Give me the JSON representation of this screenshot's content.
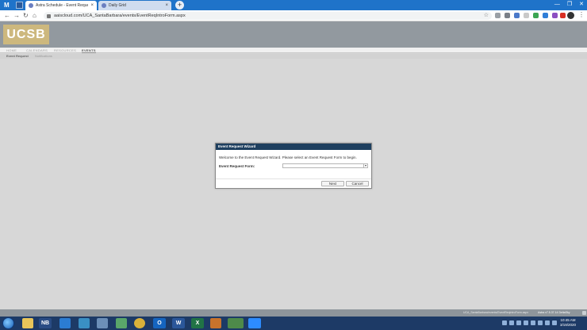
{
  "browser": {
    "tabs": [
      {
        "title": "Astra Schedule - Event Request",
        "close": "×"
      },
      {
        "title": "Daily Grid",
        "close": "×"
      }
    ],
    "new_tab": "+",
    "window_buttons": [
      "—",
      "❐",
      "✕"
    ],
    "nav": {
      "back": "←",
      "forward": "→",
      "reload": "↻",
      "home": "⌂"
    },
    "url": "aaiscloud.com/UCA_SantaBarbara/events/EventReqIntroForm.aspx",
    "star": "☆",
    "menu": "⋮"
  },
  "header": {
    "logo": "UCSB",
    "links": ""
  },
  "main_nav": {
    "tabs": [
      "HOME",
      "CALENDARS",
      "RESOURCES",
      "EVENTS"
    ],
    "active": "EVENTS"
  },
  "sub_nav": {
    "items": [
      "Event Request",
      "Notifications"
    ]
  },
  "dialog": {
    "title": "Event Request Wizard",
    "welcome": "Welcome to the Event Request Wizard. Please select an Event Request Form to begin.",
    "form_label": "Event Request Form:",
    "form_value": "",
    "next": "Next",
    "cancel": "Cancel"
  },
  "footer": {
    "path": "UCA_SantaBarbara/events/EventReqIntroForm.aspx",
    "version": "Astra v7.5.37.14 DeltaSky"
  },
  "taskbar": {
    "nb_label": "NB",
    "clock_time": "10:45 AM",
    "clock_date": "3/19/2020"
  }
}
